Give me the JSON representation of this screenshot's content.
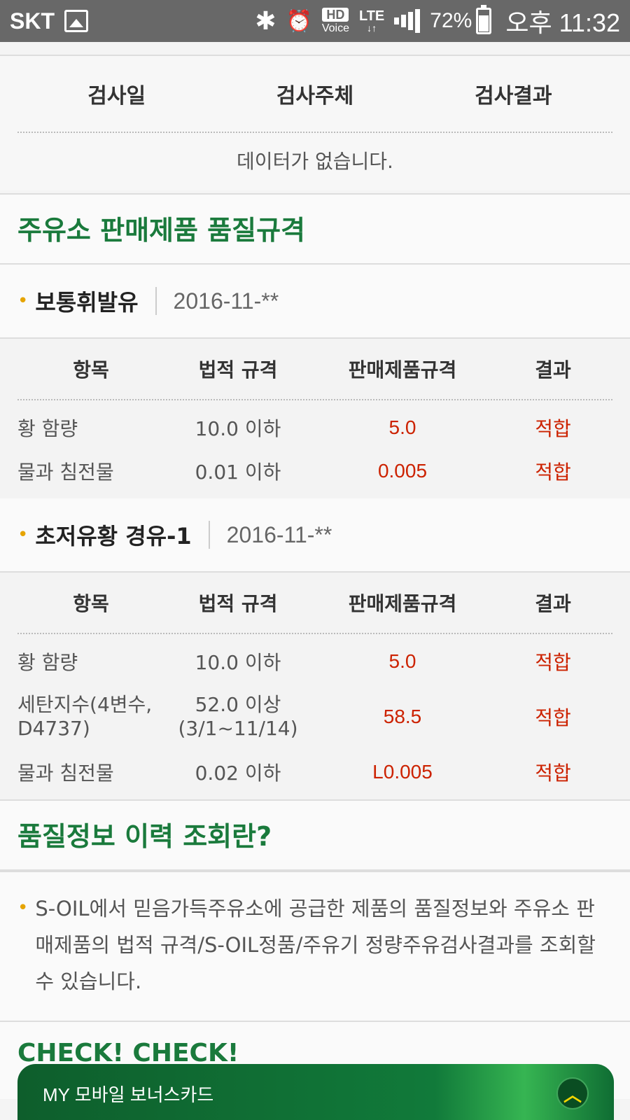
{
  "status_bar": {
    "carrier": "SKT",
    "hd_label": "HD",
    "hd_sub": "Voice",
    "network": "LTE",
    "network_arrows": "↓↑",
    "battery_pct": "72%",
    "time": "오후 11:32",
    "icons": [
      "image-icon",
      "bluetooth-icon",
      "alarm-icon",
      "signal-icon",
      "battery-icon"
    ]
  },
  "inspection": {
    "headers": [
      "검사일",
      "검사주체",
      "검사결과"
    ],
    "no_data": "데이터가 없습니다."
  },
  "quality_spec": {
    "title": "주유소 판매제품 품질규격",
    "products": [
      {
        "name": "보통휘발유",
        "date": "2016-11-**",
        "headers": [
          "항목",
          "법적 규격",
          "판매제품규격",
          "결과"
        ],
        "rows": [
          {
            "item": "황 함량",
            "legal": "10.0 이하",
            "product": "5.0",
            "result": "적합"
          },
          {
            "item": "물과 침전물",
            "legal": "0.01 이하",
            "product": "0.005",
            "result": "적합"
          }
        ]
      },
      {
        "name": "초저유황 경유-1",
        "date": "2016-11-**",
        "headers": [
          "항목",
          "법적 규격",
          "판매제품규격",
          "결과"
        ],
        "rows": [
          {
            "item": "황 함량",
            "legal": "10.0 이하",
            "product": "5.0",
            "result": "적합"
          },
          {
            "item": "세탄지수(4변수, D4737)",
            "legal": "52.0 이상 (3/1~11/14)",
            "product": "58.5",
            "result": "적합"
          },
          {
            "item": "물과 침전물",
            "legal": "0.02 이하",
            "product": "L0.005",
            "result": "적합"
          }
        ]
      }
    ]
  },
  "history_info": {
    "title": "품질정보 이력 조회란?",
    "text": "S-OIL에서 믿음가득주유소에 공급한 제품의 품질정보와 주유소 판매제품의 법적 규격/S-OIL정품/주유기 정량주유검사결과를 조회할 수 있습니다."
  },
  "check_section": {
    "title": "CHECK! CHECK!"
  },
  "bonus_bar": {
    "label": "MY 모바일 보너스카드",
    "up_icon": "chevron-up-icon"
  },
  "colors": {
    "brand_green": "#1a7a3c",
    "result_red": "#cc2200",
    "bullet_yellow": "#e6a400"
  }
}
